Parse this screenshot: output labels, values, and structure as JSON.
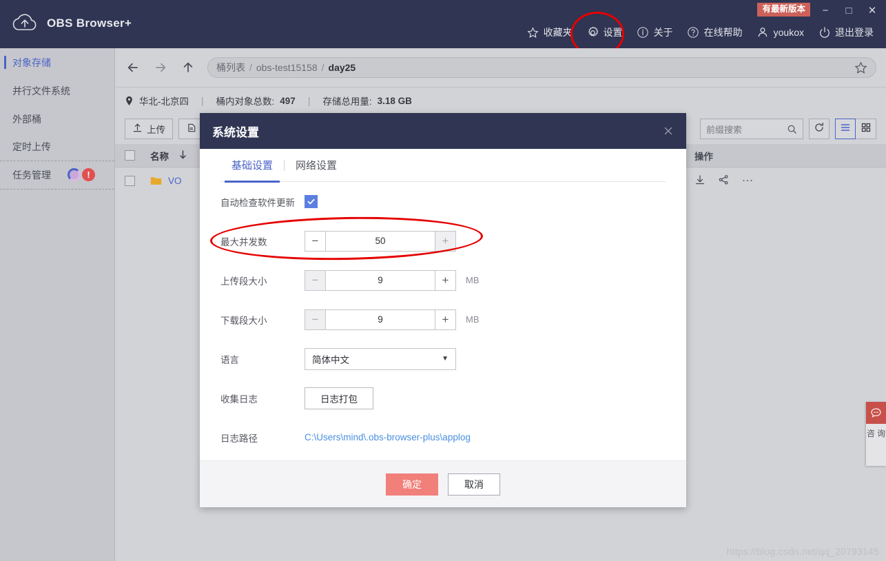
{
  "app": {
    "title": "OBS Browser+",
    "logo_icon": "cloud-upload-icon",
    "update_badge": "有最新版本"
  },
  "window_controls": {
    "minimize": "−",
    "maximize": "□",
    "close": "✕"
  },
  "header": {
    "items": [
      {
        "label": "收藏夹",
        "icon": "star-icon"
      },
      {
        "label": "设置",
        "icon": "gear-icon"
      },
      {
        "label": "关于",
        "icon": "info-icon"
      },
      {
        "label": "在线帮助",
        "icon": "question-icon"
      },
      {
        "label": "youkox",
        "icon": "user-icon"
      },
      {
        "label": "退出登录",
        "icon": "power-icon"
      }
    ]
  },
  "sidebar": {
    "items": [
      {
        "label": "对象存储",
        "active": true
      },
      {
        "label": "并行文件系统",
        "active": false
      },
      {
        "label": "外部桶",
        "active": false
      },
      {
        "label": "定时上传",
        "active": false
      },
      {
        "label": "任务管理",
        "active": false,
        "error_badge": "!"
      }
    ]
  },
  "nav": {
    "back_icon": "arrow-left-icon",
    "forward_icon": "arrow-right-icon",
    "up_icon": "arrow-up-icon",
    "favorite_icon": "star-outline-icon",
    "breadcrumb": [
      "桶列表",
      "obs-test15158",
      "day25"
    ],
    "separator": "/"
  },
  "infobar": {
    "region_icon": "location-pin-icon",
    "region": "华北-北京四",
    "object_count_label": "桶内对象总数:",
    "object_count": "497",
    "storage_label": "存储总用量:",
    "storage_value": "3.18 GB",
    "divider": "|"
  },
  "toolbar": {
    "upload_label": "上传",
    "upload_icon": "upload-icon",
    "newfolder_icon": "new-folder-icon",
    "search_placeholder": "前缀搜索",
    "search_icon": "search-icon",
    "refresh_icon": "refresh-icon",
    "list_view_icon": "list-view-icon",
    "grid_view_icon": "grid-view-icon"
  },
  "table": {
    "columns": {
      "name": "名称",
      "action": "操作"
    },
    "sort_icon": "sort-desc-arrow",
    "rows": [
      {
        "name": "VO",
        "folder_icon": "folder-icon",
        "actions": [
          "download-icon",
          "share-icon",
          "more-icon"
        ]
      }
    ]
  },
  "dialog": {
    "title": "系统设置",
    "close_icon": "close-icon",
    "tabs": [
      {
        "label": "基础设置",
        "active": true
      },
      {
        "label": "网络设置",
        "active": false
      }
    ],
    "fields": {
      "auto_update": {
        "label": "自动检查软件更新",
        "checked": true,
        "check_icon": "check-icon"
      },
      "max_concurrency": {
        "label": "最大并发数",
        "value": "50",
        "minus": "−",
        "plus": "+",
        "minus_disabled": false,
        "plus_disabled": true
      },
      "upload_part_size": {
        "label": "上传段大小",
        "value": "9",
        "unit": "MB",
        "minus": "−",
        "plus": "+",
        "minus_disabled": true,
        "plus_disabled": false
      },
      "download_part_size": {
        "label": "下载段大小",
        "value": "9",
        "unit": "MB",
        "minus": "−",
        "plus": "+",
        "minus_disabled": true,
        "plus_disabled": false
      },
      "language": {
        "label": "语言",
        "value": "简体中文",
        "caret": "▼"
      },
      "collect_log": {
        "label": "收集日志",
        "button": "日志打包"
      },
      "log_path": {
        "label": "日志路径",
        "value": "C:\\Users\\mind\\.obs-browser-plus\\applog"
      }
    },
    "footer": {
      "confirm": "确定",
      "cancel": "取消"
    }
  },
  "consult": {
    "label": "咨\n询",
    "icon": "chat-icon"
  },
  "watermark": "https://blog.csdn.net/qq_20793145",
  "colors": {
    "titlebar": "#2f3552",
    "accent_blue": "#4a63c8",
    "primary_button": "#f08079",
    "update_badge": "#cc6159",
    "annotation_red": "#e60000",
    "folder_yellow": "#e8a92b",
    "consult_red": "#c8504b"
  }
}
